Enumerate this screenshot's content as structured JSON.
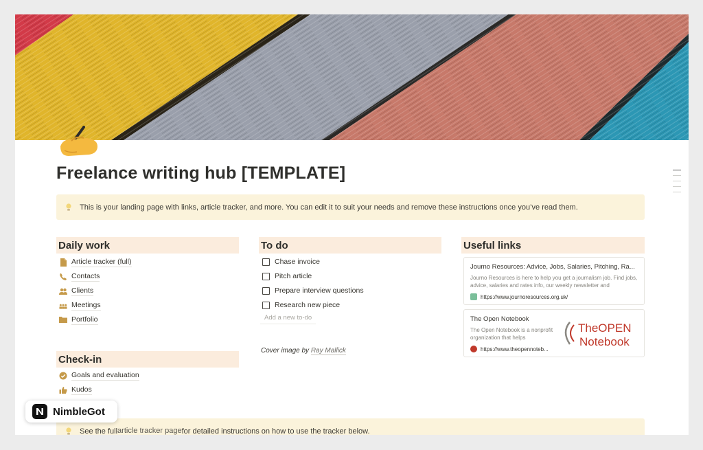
{
  "page": {
    "title": "Freelance writing hub [TEMPLATE]",
    "callout_top": "This is your landing page with links, article tracker, and more. You can edit it to suit your needs and remove these instructions once you’ve read them.",
    "callout_bottom": {
      "before": "See the full ",
      "link": "article tracker page",
      "after": " for detailed instructions on how to use the tracker below."
    }
  },
  "daily_work": {
    "heading": "Daily work",
    "items": [
      {
        "label": "Article tracker (full)",
        "icon": "page-icon"
      },
      {
        "label": "Contacts",
        "icon": "phone-icon"
      },
      {
        "label": "Clients",
        "icon": "people-icon"
      },
      {
        "label": "Meetings",
        "icon": "group-icon"
      },
      {
        "label": "Portfolio",
        "icon": "folder-icon"
      }
    ]
  },
  "check_in": {
    "heading": "Check-in",
    "items": [
      {
        "label": "Goals and evaluation",
        "icon": "check-circle-icon"
      },
      {
        "label": "Kudos",
        "icon": "thumbs-up-icon"
      }
    ]
  },
  "todo": {
    "heading": "To do",
    "items": [
      {
        "label": "Chase invoice",
        "checked": false
      },
      {
        "label": "Pitch article",
        "checked": false
      },
      {
        "label": "Prepare interview questions",
        "checked": false
      },
      {
        "label": "Research new piece",
        "checked": false
      }
    ],
    "add_placeholder": "Add a new to-do"
  },
  "credit": {
    "text": "Cover image by",
    "author": "Ray Mallick"
  },
  "useful_links": {
    "heading": "Useful links",
    "bookmarks": [
      {
        "title": "Journo Resources: Advice, Jobs, Salaries, Pitching, Ra...",
        "description": "Journo Resources is here to help you get a journalism job. Find jobs, advice, salaries and rates info, our weekly newsletter and",
        "url": "https://www.journoresources.org.uk/"
      },
      {
        "title": "The Open Notebook",
        "description": "The Open Notebook is a nonprofit organization that helps",
        "url": "https://www.theopennoteb...",
        "logo_line1_a": "The",
        "logo_line1_b": "OPEN",
        "logo_line2": "Notebook"
      }
    ]
  },
  "badge": {
    "name": "NimbleGot"
  },
  "colors": {
    "callout_bg": "#fbf3db",
    "heading_bg": "#fbecdd",
    "accent_brown": "#c59a4a",
    "notebook_red": "#c0392b"
  }
}
